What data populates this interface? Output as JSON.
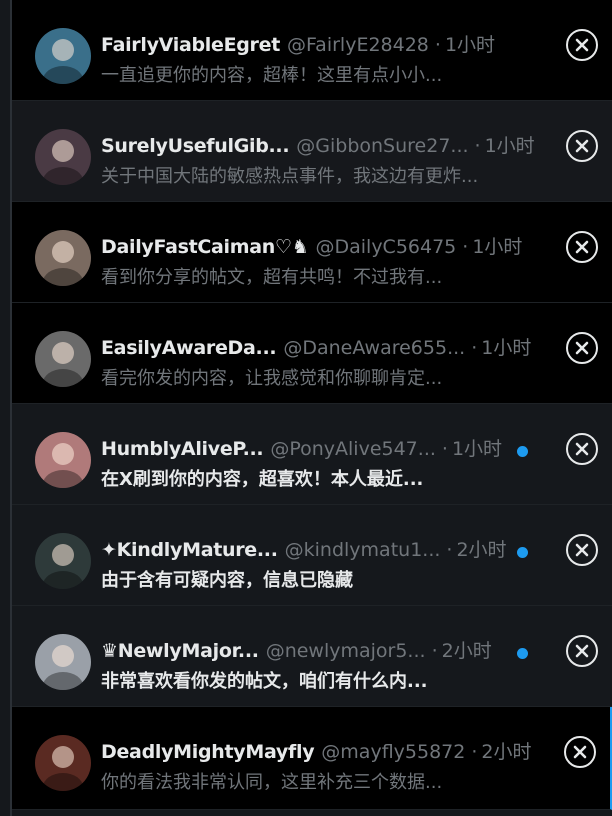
{
  "conversations": [
    {
      "name": "FairlyViableEgret",
      "handle": "@FairlyE28428",
      "sep": "·",
      "time": "1小时",
      "preview": "一直追更你的内容，超棒！这里有点小小...",
      "unread": false,
      "avatar_color": "#3a6f8a"
    },
    {
      "name": "SurelyUsefulGib...",
      "handle": "@GibbonSure27...",
      "sep": "·",
      "time": "1小时",
      "preview": "关于中国大陆的敏感热点事件，我这边有更炸...",
      "unread": false,
      "avatar_color": "#4a3a44"
    },
    {
      "name": "DailyFastCaiman♡♞",
      "handle": "@DailyC56475",
      "sep": "·",
      "time": "1小时",
      "preview": "看到你分享的帖文，超有共鸣！不过我有...",
      "unread": false,
      "avatar_color": "#7a6a60"
    },
    {
      "name": "EasilyAwareDa...",
      "handle": "@DaneAware655...",
      "sep": "·",
      "time": "1小时",
      "preview": "看完你发的内容，让我感觉和你聊聊肯定...",
      "unread": false,
      "avatar_color": "#6a6a6a"
    },
    {
      "name": "HumblyAliveP...",
      "handle": "@PonyAlive547...",
      "sep": "·",
      "time": "1小时",
      "preview": "在X刷到你的内容，超喜欢！本人最近...",
      "unread": true,
      "avatar_color": "#b07a7a"
    },
    {
      "name": "✦KindlyMature...",
      "handle": "@kindlymatu1...",
      "sep": "·",
      "time": "2小时",
      "preview": "由于含有可疑内容，信息已隐藏",
      "unread": true,
      "avatar_color": "#2e3a3a"
    },
    {
      "name": "♛NewlyMajor...",
      "handle": "@newlymajor5...",
      "sep": "·",
      "time": "2小时",
      "preview": "非常喜欢看你发的帖文，咱们有什么内...",
      "unread": true,
      "avatar_color": "#9aa0a8"
    },
    {
      "name": "DeadlyMightyMayfly",
      "handle": "@mayfly55872",
      "sep": "·",
      "time": "2小时",
      "preview": "你的看法我非常认同，这里补充三个数据...",
      "unread": false,
      "avatar_color": "#5a2a22"
    }
  ],
  "colors": {
    "accent": "#1d9bf0",
    "text": "#e7e9ea",
    "muted": "#71767b"
  }
}
